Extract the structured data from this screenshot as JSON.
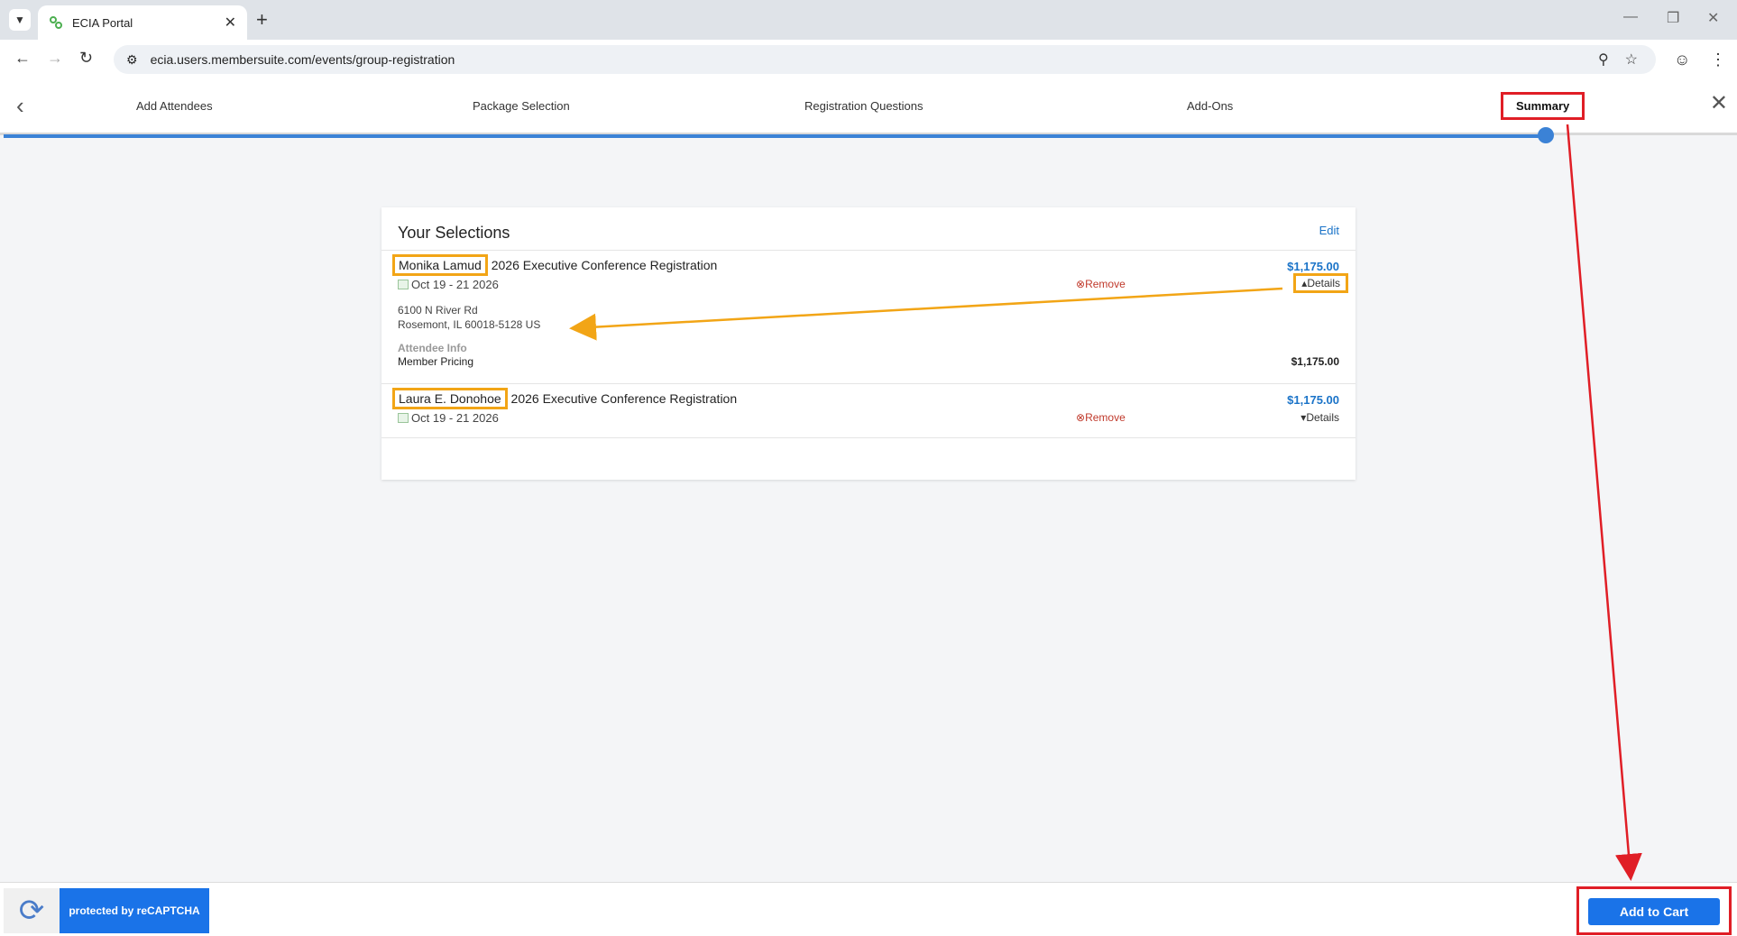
{
  "browser": {
    "tab_title": "ECIA Portal",
    "url": "ecia.users.membersuite.com/events/group-registration"
  },
  "steps": [
    {
      "label": "Add Attendees"
    },
    {
      "label": "Package Selection"
    },
    {
      "label": "Registration Questions"
    },
    {
      "label": "Add-Ons"
    },
    {
      "label": "Summary"
    }
  ],
  "card": {
    "title": "Your Selections",
    "edit_label": "Edit",
    "registrations": [
      {
        "attendee": "Monika Lamud",
        "event": "2026 Executive Conference Registration",
        "price": "$1,175.00",
        "date": "Oct 19 - 21 2026",
        "remove_label": "Remove",
        "details_label": "Details",
        "address_line1": "6100 N River Rd",
        "address_line2": "Rosemont, IL 60018-5128 US",
        "attendee_info_label": "Attendee Info",
        "pricing_label": "Member Pricing",
        "pricing_amount": "$1,175.00"
      },
      {
        "attendee": "Laura E. Donohoe",
        "event": "2026 Executive Conference Registration",
        "price": "$1,175.00",
        "date": "Oct 19 - 21 2026",
        "remove_label": "Remove",
        "details_label": "Details"
      }
    ]
  },
  "bottom": {
    "recaptcha_text": "protected by reCAPTCHA",
    "add_to_cart_label": "Add to Cart"
  },
  "colors": {
    "accent_blue": "#1a73e8",
    "annotation_red": "#e01e26",
    "annotation_orange": "#f2a516"
  }
}
